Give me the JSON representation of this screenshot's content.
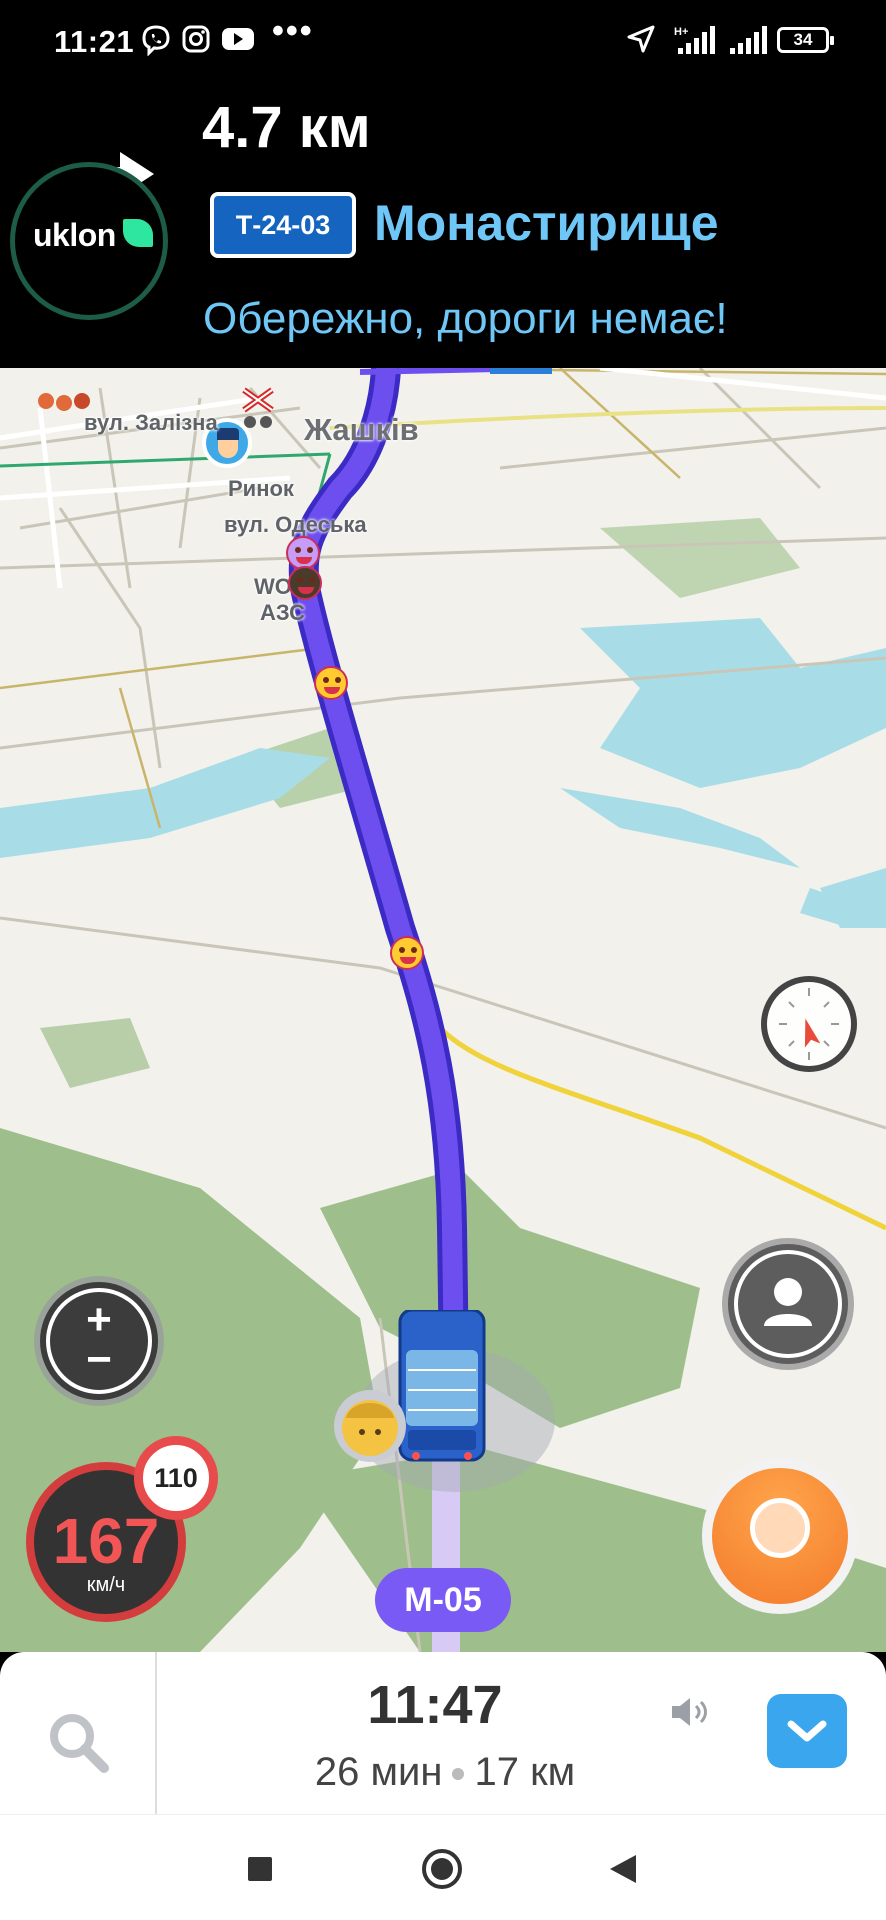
{
  "status_bar": {
    "time": "11:21",
    "battery": "34",
    "icons": [
      "viber-icon",
      "instagram-icon",
      "youtube-icon",
      "more-dots-icon",
      "location-arrow-icon",
      "signal-h-plus-icon",
      "signal-icon",
      "battery-icon"
    ],
    "more": "•••"
  },
  "instruction": {
    "distance": "4.7 км",
    "road_number": "Т-24-03",
    "street": "Монастирище",
    "notice": "Обережно, дороги немає!",
    "maneuver": "turn-right-arrow-icon"
  },
  "overlay_app": {
    "name": "uklon",
    "accent": "#2ee6a0"
  },
  "map": {
    "labels": {
      "street_1": "вул. Залізна",
      "town": "Жашків",
      "market": "Ринок",
      "street_2": "вул. Одеська",
      "gas_1": "WOG",
      "gas_2": "АЗС"
    },
    "highway": "M-05",
    "route_color": "#6645e6"
  },
  "speed": {
    "current": "167",
    "unit": "км/ч",
    "limit": "110"
  },
  "trip": {
    "eta": "11:47",
    "duration": "26 мин",
    "distance": "17 км"
  },
  "colors": {
    "banner_bg": "#000000",
    "street_text": "#6fc7f7",
    "speed_red": "#f25555",
    "report_orange": "#f37a2a",
    "chevron_blue": "#3aa6ee"
  }
}
